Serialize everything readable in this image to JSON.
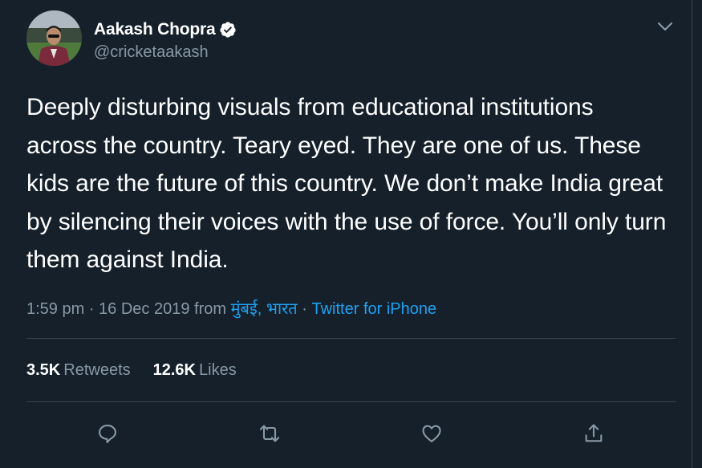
{
  "tweet": {
    "author": {
      "display_name": "Aakash Chopra",
      "handle": "@cricketaakash",
      "verified": true,
      "avatar": "avatar-photo"
    },
    "text": "Deeply disturbing visuals from educational institutions across the country. Teary eyed. They are one of us. These kids are the future of this country. We don’t make India great by silencing their voices with the use of force. You’ll only turn them against India.",
    "meta": {
      "time": "1:59 pm · 16 Dec 2019 from ",
      "location": "मुंबई, भारत",
      "separator": " · ",
      "source": "Twitter for iPhone"
    },
    "stats": {
      "retweets_count": "3.5K",
      "retweets_label": "Retweets",
      "likes_count": "12.6K",
      "likes_label": "Likes"
    },
    "actions": [
      {
        "name": "reply",
        "icon": "reply-icon"
      },
      {
        "name": "retweet",
        "icon": "retweet-icon"
      },
      {
        "name": "like",
        "icon": "heart-icon"
      },
      {
        "name": "share",
        "icon": "share-icon"
      }
    ]
  },
  "colors": {
    "background": "#15202b",
    "text_primary": "#ffffff",
    "text_secondary": "#8899a6",
    "accent": "#1da1f2",
    "divider": "#38444d"
  }
}
